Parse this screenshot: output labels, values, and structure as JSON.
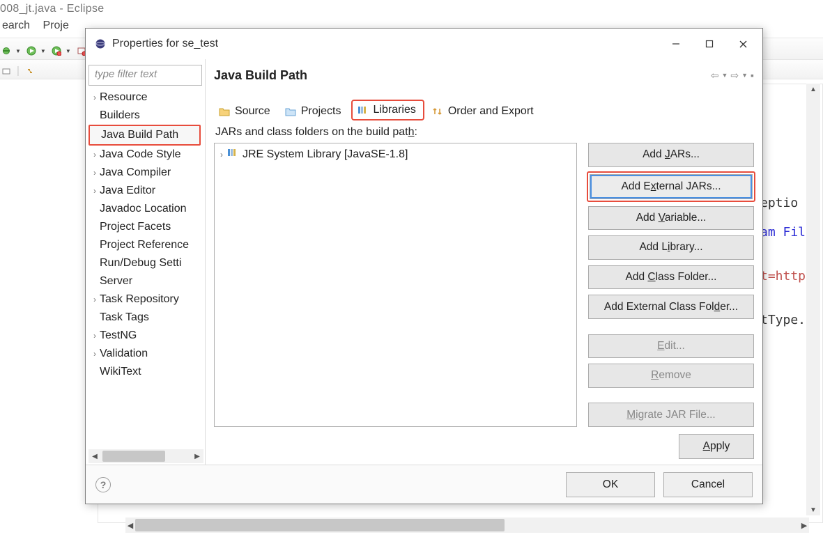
{
  "eclipse": {
    "window_title": "008_jt.java - Eclipse",
    "menu": {
      "item0": "earch",
      "item1": "Proje"
    },
    "code": {
      "l1": "eptio",
      "l2": "am Fil",
      "l3": "t=http",
      "l4": "tType."
    }
  },
  "dialog": {
    "title": "Properties for se_test",
    "filter_placeholder": "type filter text",
    "nav": {
      "resource": "Resource",
      "builders": "Builders",
      "java_build_path": "Java Build Path",
      "java_code_style": "Java Code Style",
      "java_compiler": "Java Compiler",
      "java_editor": "Java Editor",
      "javadoc_location": "Javadoc Location",
      "project_facets": "Project Facets",
      "project_references": "Project Reference",
      "run_debug": "Run/Debug Setti",
      "server": "Server",
      "task_repository": "Task Repository",
      "task_tags": "Task Tags",
      "testng": "TestNG",
      "validation": "Validation",
      "wikitext": "WikiText"
    },
    "main_title": "Java Build Path",
    "tabs": {
      "source": "Source",
      "projects": "Projects",
      "libraries": "Libraries",
      "order_export": "Order and Export"
    },
    "subtitle_pre": "JARs and class folders on the build pat",
    "subtitle_u": "h",
    "subtitle_post": ":",
    "list": {
      "item0": "JRE System Library [JavaSE-1.8]"
    },
    "buttons": {
      "add_jars_pre": "Add ",
      "add_jars_u": "J",
      "add_jars_post": "ARs...",
      "add_ext_jars_pre": "Add E",
      "add_ext_jars_u": "x",
      "add_ext_jars_post": "ternal JARs...",
      "add_var_pre": "Add ",
      "add_var_u": "V",
      "add_var_post": "ariable...",
      "add_lib_pre": "Add L",
      "add_lib_u": "i",
      "add_lib_post": "brary...",
      "add_cf_pre": "Add ",
      "add_cf_u": "C",
      "add_cf_post": "lass Folder...",
      "add_ecf_pre": "Add External Class Fol",
      "add_ecf_u": "d",
      "add_ecf_post": "er...",
      "edit_u": "E",
      "edit_post": "dit...",
      "remove_u": "R",
      "remove_post": "emove",
      "migrate_u": "M",
      "migrate_post": "igrate JAR File...",
      "apply_u": "A",
      "apply_post": "pply",
      "ok": "OK",
      "cancel": "Cancel"
    }
  }
}
